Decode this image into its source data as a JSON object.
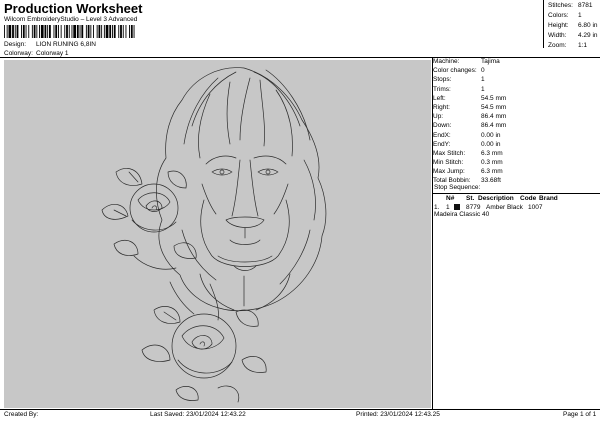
{
  "header": {
    "title": "Production Worksheet",
    "subtitle": "Wilcom EmbroideryStudio – Level 3 Advanced",
    "design_label": "Design:",
    "design_value": "LION RUNING 6,8IN",
    "colorway_label": "Colorway:",
    "colorway_value": "Colorway 1"
  },
  "stats": [
    {
      "label": "Stitches:",
      "value": "8781"
    },
    {
      "label": "Colors:",
      "value": "1"
    },
    {
      "label": "Height:",
      "value": "6.80 in"
    },
    {
      "label": "Width:",
      "value": "4.29 in"
    },
    {
      "label": "Zoom:",
      "value": "1:1"
    }
  ],
  "details": [
    {
      "label": "Machine:",
      "value": "Tajima"
    },
    {
      "label": "Color changes:",
      "value": "0"
    },
    {
      "label": "Stops:",
      "value": "1"
    },
    {
      "label": "Trims:",
      "value": "1"
    },
    {
      "label": "Left:",
      "value": "54.5 mm"
    },
    {
      "label": "Right:",
      "value": "54.5 mm"
    },
    {
      "label": "Up:",
      "value": "86.4 mm"
    },
    {
      "label": "Down:",
      "value": "86.4 mm"
    },
    {
      "label": "EndX:",
      "value": "0.00 in"
    },
    {
      "label": "EndY:",
      "value": "0.00 in"
    },
    {
      "label": "Max Stitch:",
      "value": "6.3 mm"
    },
    {
      "label": "Min Stitch:",
      "value": "0.3 mm"
    },
    {
      "label": "Max Jump:",
      "value": "6.3 mm"
    },
    {
      "label": "Total Bobbin:",
      "value": "33.68ft"
    }
  ],
  "stop_sequence": {
    "label": "Stop Sequence:",
    "headers": {
      "n": "N#",
      "st": "St.",
      "desc": "Description",
      "code": "Code",
      "brand": "Brand"
    },
    "rows": [
      {
        "index": "1.",
        "n": "1",
        "st": "8779",
        "desc": "Amber Black",
        "code": "1007",
        "brand": "Madeira Classic 40",
        "swatch": "#111111"
      }
    ]
  },
  "footer": {
    "created": "Created By:",
    "saved": "Last Saved: 23/01/2024 12:43.22",
    "printed": "Printed: 23/01/2024 12:43.25",
    "page": "Page 1 of 1"
  },
  "colors": {
    "canvas": "#c7c7c7",
    "thread": "#2b2b2b"
  }
}
